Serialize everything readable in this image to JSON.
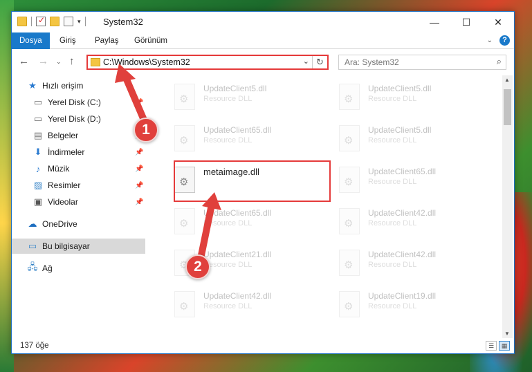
{
  "window": {
    "title": "System32",
    "controls": {
      "minimize": "—",
      "maximize": "☐",
      "close": "✕"
    }
  },
  "ribbon": {
    "tabs": [
      {
        "label": "Dosya",
        "active": true
      },
      {
        "label": "Giriş",
        "active": false
      },
      {
        "label": "Paylaş",
        "active": false
      },
      {
        "label": "Görünüm",
        "active": false
      }
    ],
    "help": "?"
  },
  "address": {
    "path": "C:\\Windows\\System32",
    "refresh": "↻",
    "dropdown": "⌄"
  },
  "search": {
    "placeholder": "Ara: System32",
    "icon": "⌕"
  },
  "sidebar": {
    "quick_access": "Hızlı erişim",
    "items": [
      {
        "label": "Yerel Disk (C:)",
        "icon": "drive-icon",
        "pinned": true
      },
      {
        "label": "Yerel Disk (D:)",
        "icon": "drive-icon",
        "pinned": false
      },
      {
        "label": "Belgeler",
        "icon": "documents-icon",
        "pinned": true
      },
      {
        "label": "İndirmeler",
        "icon": "download-icon",
        "pinned": true
      },
      {
        "label": "Müzik",
        "icon": "music-icon",
        "pinned": true
      },
      {
        "label": "Resimler",
        "icon": "pictures-icon",
        "pinned": true
      },
      {
        "label": "Videolar",
        "icon": "videos-icon",
        "pinned": true
      }
    ],
    "onedrive": "OneDrive",
    "this_pc": "Bu bilgisayar",
    "network": "Ağ"
  },
  "files": {
    "left": [
      {
        "name": "UpdateClient5.dll",
        "type": "Resource DLL"
      },
      {
        "name": "UpdateClient65.dll",
        "type": "Resource DLL"
      },
      {
        "name": "metaimage.dll",
        "type": ""
      },
      {
        "name": "UpdateClient65.dll",
        "type": "Resource DLL"
      },
      {
        "name": "UpdateClient21.dll",
        "type": "Resource DLL"
      },
      {
        "name": "UpdateClient42.dll",
        "type": "Resource DLL"
      }
    ],
    "right": [
      {
        "name": "UpdateClient5.dll",
        "type": "Resource DLL"
      },
      {
        "name": "UpdateClient5.dll",
        "type": "Resource DLL"
      },
      {
        "name": "UpdateClient65.dll",
        "type": "Resource DLL"
      },
      {
        "name": "UpdateClient42.dll",
        "type": "Resource DLL"
      },
      {
        "name": "UpdateClient42.dll",
        "type": "Resource DLL"
      },
      {
        "name": "UpdateClient19.dll",
        "type": "Resource DLL"
      }
    ]
  },
  "status": {
    "count": "137 öğe"
  },
  "annotations": {
    "step1": "1",
    "step2": "2",
    "color": "#e0403c"
  }
}
